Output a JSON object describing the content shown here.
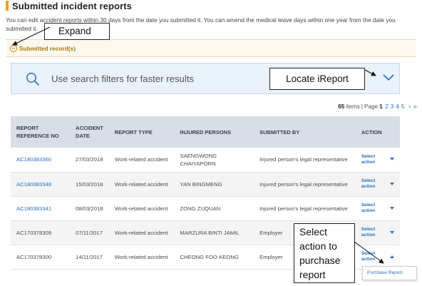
{
  "page": {
    "title": "Submitted incident reports",
    "description": "You can edit accident reports within 30 days from the date you submitted it. You can amend the medical leave days within one year from the date you submitted it."
  },
  "records_section": {
    "label": "Submitted record(s)"
  },
  "search": {
    "placeholder": "Use search filters for faster results"
  },
  "callouts": {
    "expand": "Expand",
    "locate": "Locate iReport",
    "select_lines": [
      "Select",
      "action to",
      "purchase",
      "report"
    ]
  },
  "pagination": {
    "count": "65",
    "items_label": "items",
    "page_label": "Page",
    "current": "1",
    "pages": [
      "2",
      "3",
      "4",
      "5"
    ],
    "next": "›",
    "last": "»"
  },
  "table": {
    "headers": [
      "REPORT REFERENCE NO",
      "ACCIDENT DATE",
      "REPORT TYPE",
      "INJURED PERSONS",
      "SUBMITTED BY",
      "ACTION"
    ],
    "rows": [
      {
        "ref": "AC180383360",
        "date": "27/03/2018",
        "type": "Work-related accident",
        "person": "SAENGWONG CHAIYAPORN",
        "by": "Injured person's legal representative",
        "action": "Select action"
      },
      {
        "ref": "AC180383348",
        "date": "15/03/2018",
        "type": "Work-related accident",
        "person": "YAN BINGMENG",
        "by": "Injured person's legal representative",
        "action": "Select action"
      },
      {
        "ref": "AC180383341",
        "date": "08/03/2018",
        "type": "Work-related accident",
        "person": "ZONG ZUQUAN",
        "by": "Injured person's legal representative",
        "action": "Select action"
      },
      {
        "ref": "AC170378309",
        "date": "07/11/2017",
        "type": "Work-related accident",
        "person": "MARZURA BINTI JAMIL",
        "by": "Employer",
        "action": "Select action"
      },
      {
        "ref": "AC170378300",
        "date": "14/11/2017",
        "type": "Work-related accident",
        "person": "CHEONG FOO KEONG",
        "by": "Employer",
        "action": "Select action"
      }
    ]
  },
  "dropdown": {
    "option": "Purchase Report"
  },
  "colors": {
    "accent": "#e8a317",
    "link": "#2a6ebb",
    "header_bg": "#d8dee6",
    "search_bg": "#e9f2fb",
    "records_bg": "#fdf8ee"
  }
}
